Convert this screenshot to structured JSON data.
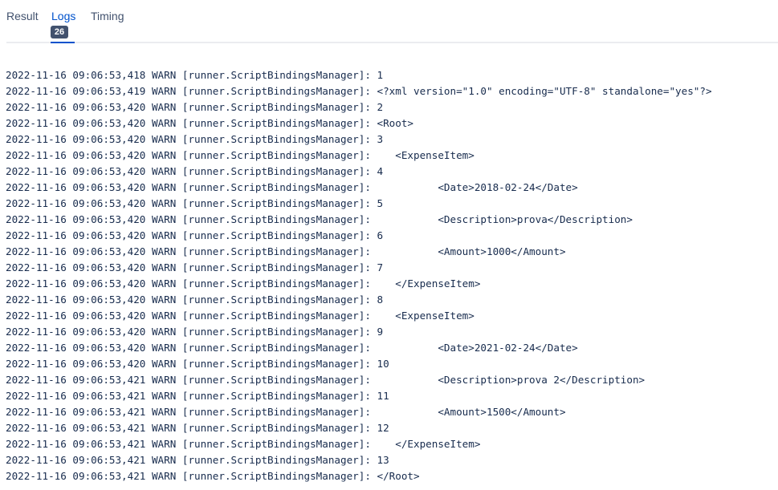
{
  "tabs": {
    "result": "Result",
    "logs": "Logs",
    "timing": "Timing",
    "logs_badge": "26",
    "active": "Logs"
  },
  "log_lines": [
    "2022-11-16 09:06:53,418 WARN [runner.ScriptBindingsManager]: 1",
    "2022-11-16 09:06:53,419 WARN [runner.ScriptBindingsManager]: <?xml version=\"1.0\" encoding=\"UTF-8\" standalone=\"yes\"?>",
    "2022-11-16 09:06:53,420 WARN [runner.ScriptBindingsManager]: 2",
    "2022-11-16 09:06:53,420 WARN [runner.ScriptBindingsManager]: <Root>",
    "2022-11-16 09:06:53,420 WARN [runner.ScriptBindingsManager]: 3",
    "2022-11-16 09:06:53,420 WARN [runner.ScriptBindingsManager]:    <ExpenseItem>",
    "2022-11-16 09:06:53,420 WARN [runner.ScriptBindingsManager]: 4",
    "2022-11-16 09:06:53,420 WARN [runner.ScriptBindingsManager]:           <Date>2018-02-24</Date>",
    "2022-11-16 09:06:53,420 WARN [runner.ScriptBindingsManager]: 5",
    "2022-11-16 09:06:53,420 WARN [runner.ScriptBindingsManager]:           <Description>prova</Description>",
    "2022-11-16 09:06:53,420 WARN [runner.ScriptBindingsManager]: 6",
    "2022-11-16 09:06:53,420 WARN [runner.ScriptBindingsManager]:           <Amount>1000</Amount>",
    "2022-11-16 09:06:53,420 WARN [runner.ScriptBindingsManager]: 7",
    "2022-11-16 09:06:53,420 WARN [runner.ScriptBindingsManager]:    </ExpenseItem>",
    "2022-11-16 09:06:53,420 WARN [runner.ScriptBindingsManager]: 8",
    "2022-11-16 09:06:53,420 WARN [runner.ScriptBindingsManager]:    <ExpenseItem>",
    "2022-11-16 09:06:53,420 WARN [runner.ScriptBindingsManager]: 9",
    "2022-11-16 09:06:53,420 WARN [runner.ScriptBindingsManager]:           <Date>2021-02-24</Date>",
    "2022-11-16 09:06:53,420 WARN [runner.ScriptBindingsManager]: 10",
    "2022-11-16 09:06:53,421 WARN [runner.ScriptBindingsManager]:           <Description>prova 2</Description>",
    "2022-11-16 09:06:53,421 WARN [runner.ScriptBindingsManager]: 11",
    "2022-11-16 09:06:53,421 WARN [runner.ScriptBindingsManager]:           <Amount>1500</Amount>",
    "2022-11-16 09:06:53,421 WARN [runner.ScriptBindingsManager]: 12",
    "2022-11-16 09:06:53,421 WARN [runner.ScriptBindingsManager]:    </ExpenseItem>",
    "2022-11-16 09:06:53,421 WARN [runner.ScriptBindingsManager]: 13",
    "2022-11-16 09:06:53,421 WARN [runner.ScriptBindingsManager]: </Root>"
  ],
  "colors": {
    "active_tab": "#0052cc",
    "inactive_tab": "#42526e",
    "badge_bg": "#42526e",
    "log_text": "#172b4d",
    "divider": "#ebecf0"
  }
}
